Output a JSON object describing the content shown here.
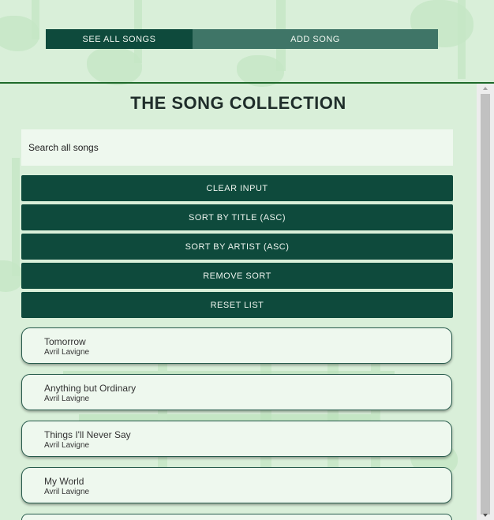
{
  "nav": {
    "see_all": "SEE ALL SONGS",
    "add_song": "ADD SONG"
  },
  "page": {
    "title": "THE SONG COLLECTION"
  },
  "search": {
    "placeholder": "Search all songs",
    "value": ""
  },
  "buttons": {
    "clear": "CLEAR INPUT",
    "sort_title": "SORT BY TITLE (ASC)",
    "sort_artist": "SORT BY ARTIST (ASC)",
    "remove_sort": "REMOVE SORT",
    "reset": "RESET LIST"
  },
  "songs": [
    {
      "title": "Tomorrow",
      "artist": "Avril Lavigne"
    },
    {
      "title": "Anything but Ordinary",
      "artist": "Avril Lavigne"
    },
    {
      "title": "Things I'll Never Say",
      "artist": "Avril Lavigne"
    },
    {
      "title": "My World",
      "artist": "Avril Lavigne"
    },
    {
      "title": "",
      "artist": ""
    }
  ],
  "colors": {
    "primary": "#0e4a3c",
    "nav_inactive": "#3f7567",
    "background": "#d9efd9",
    "card": "#eef8ee",
    "divider": "#1e6a2a"
  }
}
